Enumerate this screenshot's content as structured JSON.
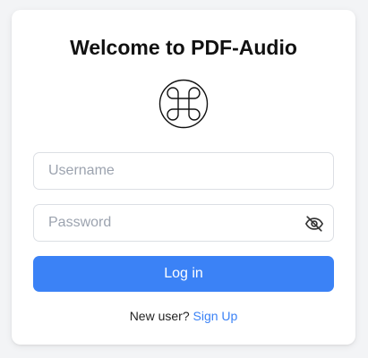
{
  "login": {
    "title": "Welcome to PDF-Audio",
    "logo_icon": "command-key-icon",
    "username": {
      "placeholder": "Username",
      "value": ""
    },
    "password": {
      "placeholder": "Password",
      "value": "",
      "toggle_icon": "eye-off-icon"
    },
    "login_label": "Log in",
    "new_user_text": "New user?",
    "signup_label": "Sign Up"
  },
  "colors": {
    "primary": "#3b82f6",
    "background": "#f3f4f6",
    "card": "#ffffff"
  }
}
